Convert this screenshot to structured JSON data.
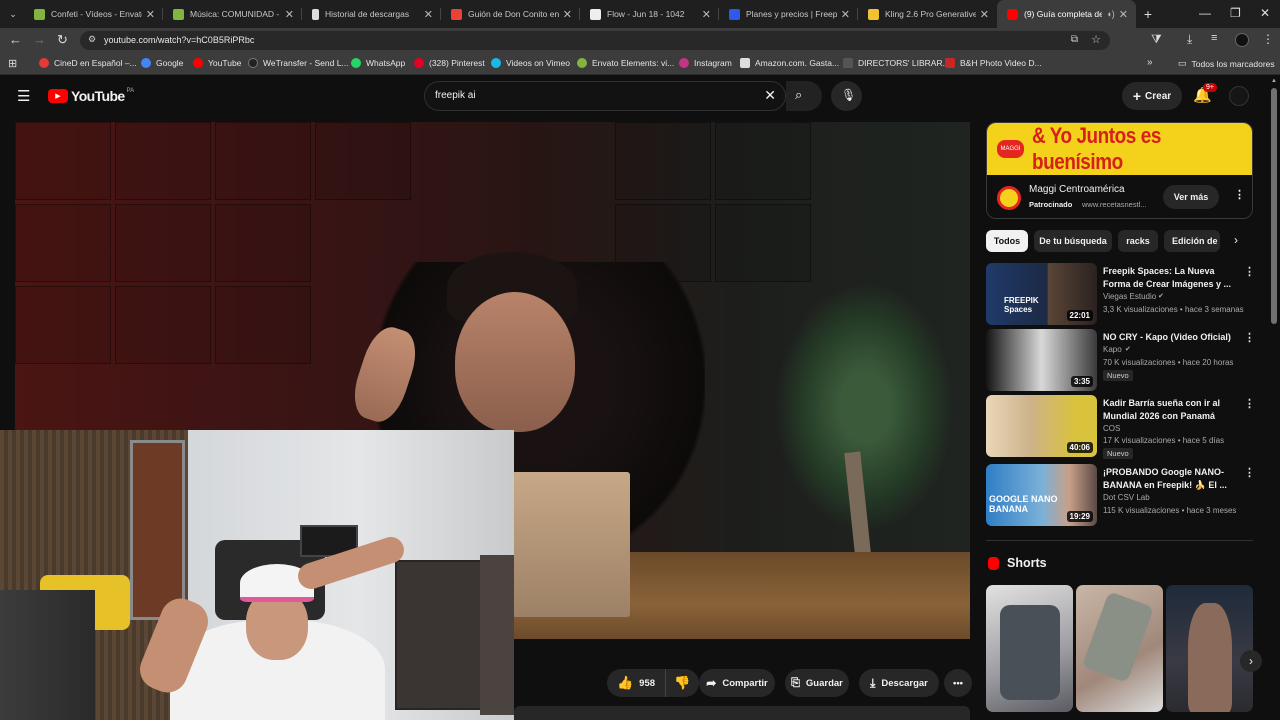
{
  "browser": {
    "tabs": [
      {
        "title": "Confeti - Vídeos - Envato",
        "fav_color": "#82b440"
      },
      {
        "title": "Música: COMUNIDAD - E",
        "fav_color": "#82b440"
      },
      {
        "title": "Historial de descargas",
        "fav_color": "#dddddd"
      },
      {
        "title": "Guión de Don Conito en",
        "fav_color": "#ea4335"
      },
      {
        "title": "Flow - Jun 18 - 1042",
        "fav_color": "#eeeeee"
      },
      {
        "title": "Planes y precios | Freepik",
        "fav_color": "#2d5ae6"
      },
      {
        "title": "Kling 2.6 Pro Generative /",
        "fav_color": "#f1c232"
      },
      {
        "title": "(9) Guía completa de",
        "fav_color": "#ff0000"
      }
    ],
    "url": "youtube.com/watch?v=hC0B5RiPRbc",
    "bookmarks": [
      {
        "label": "CineD en Español –...",
        "color": "#e53935"
      },
      {
        "label": "Google",
        "color": "#4285f4"
      },
      {
        "label": "YouTube",
        "color": "#ff0000"
      },
      {
        "label": "WeTransfer - Send L...",
        "color": "#222222"
      },
      {
        "label": "WhatsApp",
        "color": "#25d366"
      },
      {
        "label": "(328) Pinterest",
        "color": "#e60023"
      },
      {
        "label": "Videos on Vimeo",
        "color": "#1ab7ea"
      },
      {
        "label": "Envato Elements: vi...",
        "color": "#82b440"
      },
      {
        "label": "Instagram",
        "color": "#c13584"
      },
      {
        "label": "Amazon.com. Gasta...",
        "color": "#dddddd"
      },
      {
        "label": "DIRECTORS' LIBRAR...",
        "color": "#555555"
      },
      {
        "label": "B&H Photo Video D...",
        "color": "#c62828"
      }
    ],
    "all_bookmarks": "Todos los marcadores"
  },
  "youtube": {
    "logo": "YouTube",
    "region": "PA",
    "search_value": "freepik ai",
    "create_label": "Crear",
    "notifications": "9+"
  },
  "video_actions": {
    "likes": "958",
    "share": "Compartir",
    "save": "Guardar",
    "download": "Descargar"
  },
  "ad": {
    "banner": "& Yo Juntos es buenísimo",
    "brand": "Maggi Centroamérica",
    "sponsored": "Patrocinado",
    "url": "www.recetasnestl...",
    "cta": "Ver más",
    "logo_text": "MAGGI"
  },
  "chips": [
    "Todos",
    "De tu búsqueda",
    "racks",
    "Edición de"
  ],
  "recommendations": [
    {
      "title": "Freepik Spaces: La Nueva Forma de Crear Imágenes y ...",
      "channel": "Viegas Estudio",
      "meta": "3,3 K visualizaciones • hace 3 semanas",
      "duration": "22:01",
      "badge": "",
      "thumb_text": "FREEPIK Spaces"
    },
    {
      "title": "NO CRY - Kapo (Video Oficial)",
      "channel": "Kapo",
      "meta": "70 K visualizaciones • hace 20 horas",
      "duration": "3:35",
      "badge": "Nuevo",
      "thumb_text": ""
    },
    {
      "title": "Kadir Barría sueña con ir al Mundial 2026 con Panamá",
      "channel": "COS",
      "meta": "17 K visualizaciones • hace 5 días",
      "duration": "40:06",
      "badge": "Nuevo",
      "thumb_text": ""
    },
    {
      "title": "¡PROBANDO Google NANO-BANANA en Freepik! 🍌 El ...",
      "channel": "Dot CSV Lab",
      "meta": "115 K visualizaciones • hace 3 meses",
      "duration": "19:29",
      "badge": "",
      "thumb_text": "GOOGLE NANO BANANA"
    }
  ],
  "shorts_label": "Shorts",
  "icons": {
    "menu": "hamburger-icon",
    "search": "search-icon",
    "mic": "mic-icon",
    "clear": "close-icon",
    "bell": "bell-icon",
    "like": "thumbs-up-icon",
    "dislike": "thumbs-down-icon",
    "share": "share-icon",
    "save": "bookmark-icon",
    "download": "download-icon"
  }
}
